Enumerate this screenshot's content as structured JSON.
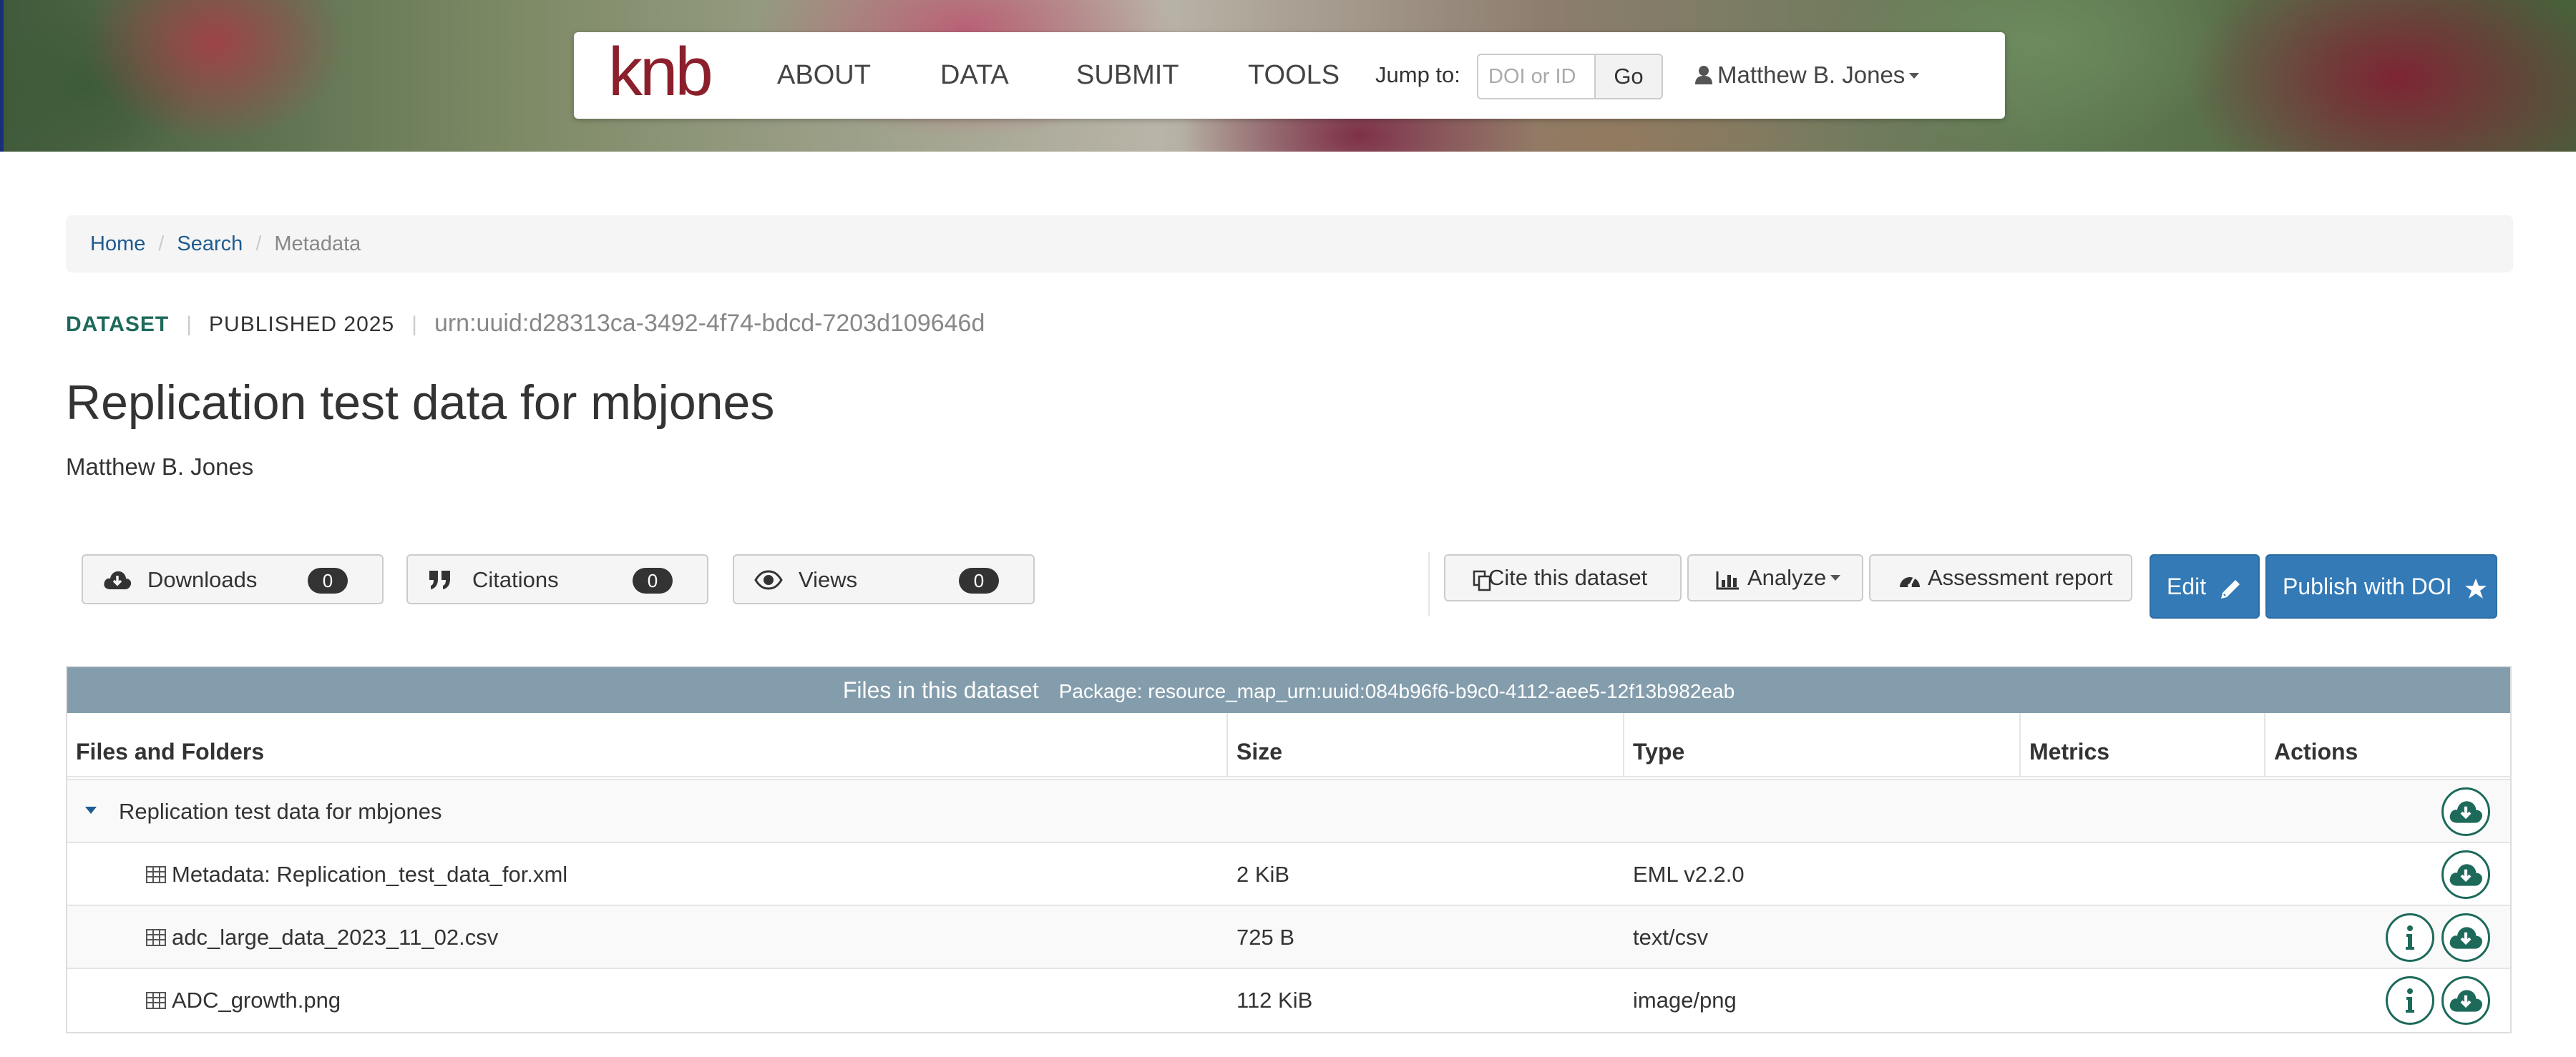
{
  "nav": {
    "logo": "knb",
    "items": [
      "ABOUT",
      "DATA",
      "SUBMIT",
      "TOOLS"
    ],
    "jump_label": "Jump to:",
    "doi_placeholder": "DOI or ID",
    "go_label": "Go",
    "user_name": "Matthew B. Jones"
  },
  "breadcrumb": {
    "home": "Home",
    "search": "Search",
    "current": "Metadata"
  },
  "dataset": {
    "type_label": "DATASET",
    "published": "PUBLISHED 2025",
    "id": "urn:uuid:d28313ca-3492-4f74-bdcd-7203d109646d",
    "title": "Replication test data for mbjones",
    "author": "Matthew B. Jones"
  },
  "metrics": {
    "downloads_label": "Downloads",
    "downloads_count": "0",
    "citations_label": "Citations",
    "citations_count": "0",
    "views_label": "Views",
    "views_count": "0"
  },
  "actions": {
    "cite": "Cite this dataset",
    "analyze": "Analyze",
    "assessment": "Assessment report",
    "edit": "Edit",
    "publish": "Publish with DOI"
  },
  "files": {
    "header_title": "Files in this dataset",
    "package": "Package: resource_map_urn:uuid:084b96f6-b9c0-4112-aee5-12f13b982eab",
    "columns": [
      "Files and Folders",
      "Size",
      "Type",
      "Metrics",
      "Actions"
    ],
    "folder_name": "Replication test data for mbjones",
    "rows": [
      {
        "name": "Metadata: Replication_test_data_for.xml",
        "size": "2 KiB",
        "type": "EML v2.2.0"
      },
      {
        "name": "adc_large_data_2023_11_02.csv",
        "size": "725 B",
        "type": "text/csv"
      },
      {
        "name": "ADC_growth.png",
        "size": "112 KiB",
        "type": "image/png"
      }
    ]
  },
  "colors": {
    "brand": "#8b1f2b",
    "accent_teal": "#1d6a5b",
    "primary_button": "#337ab7",
    "table_header": "#849dac"
  }
}
